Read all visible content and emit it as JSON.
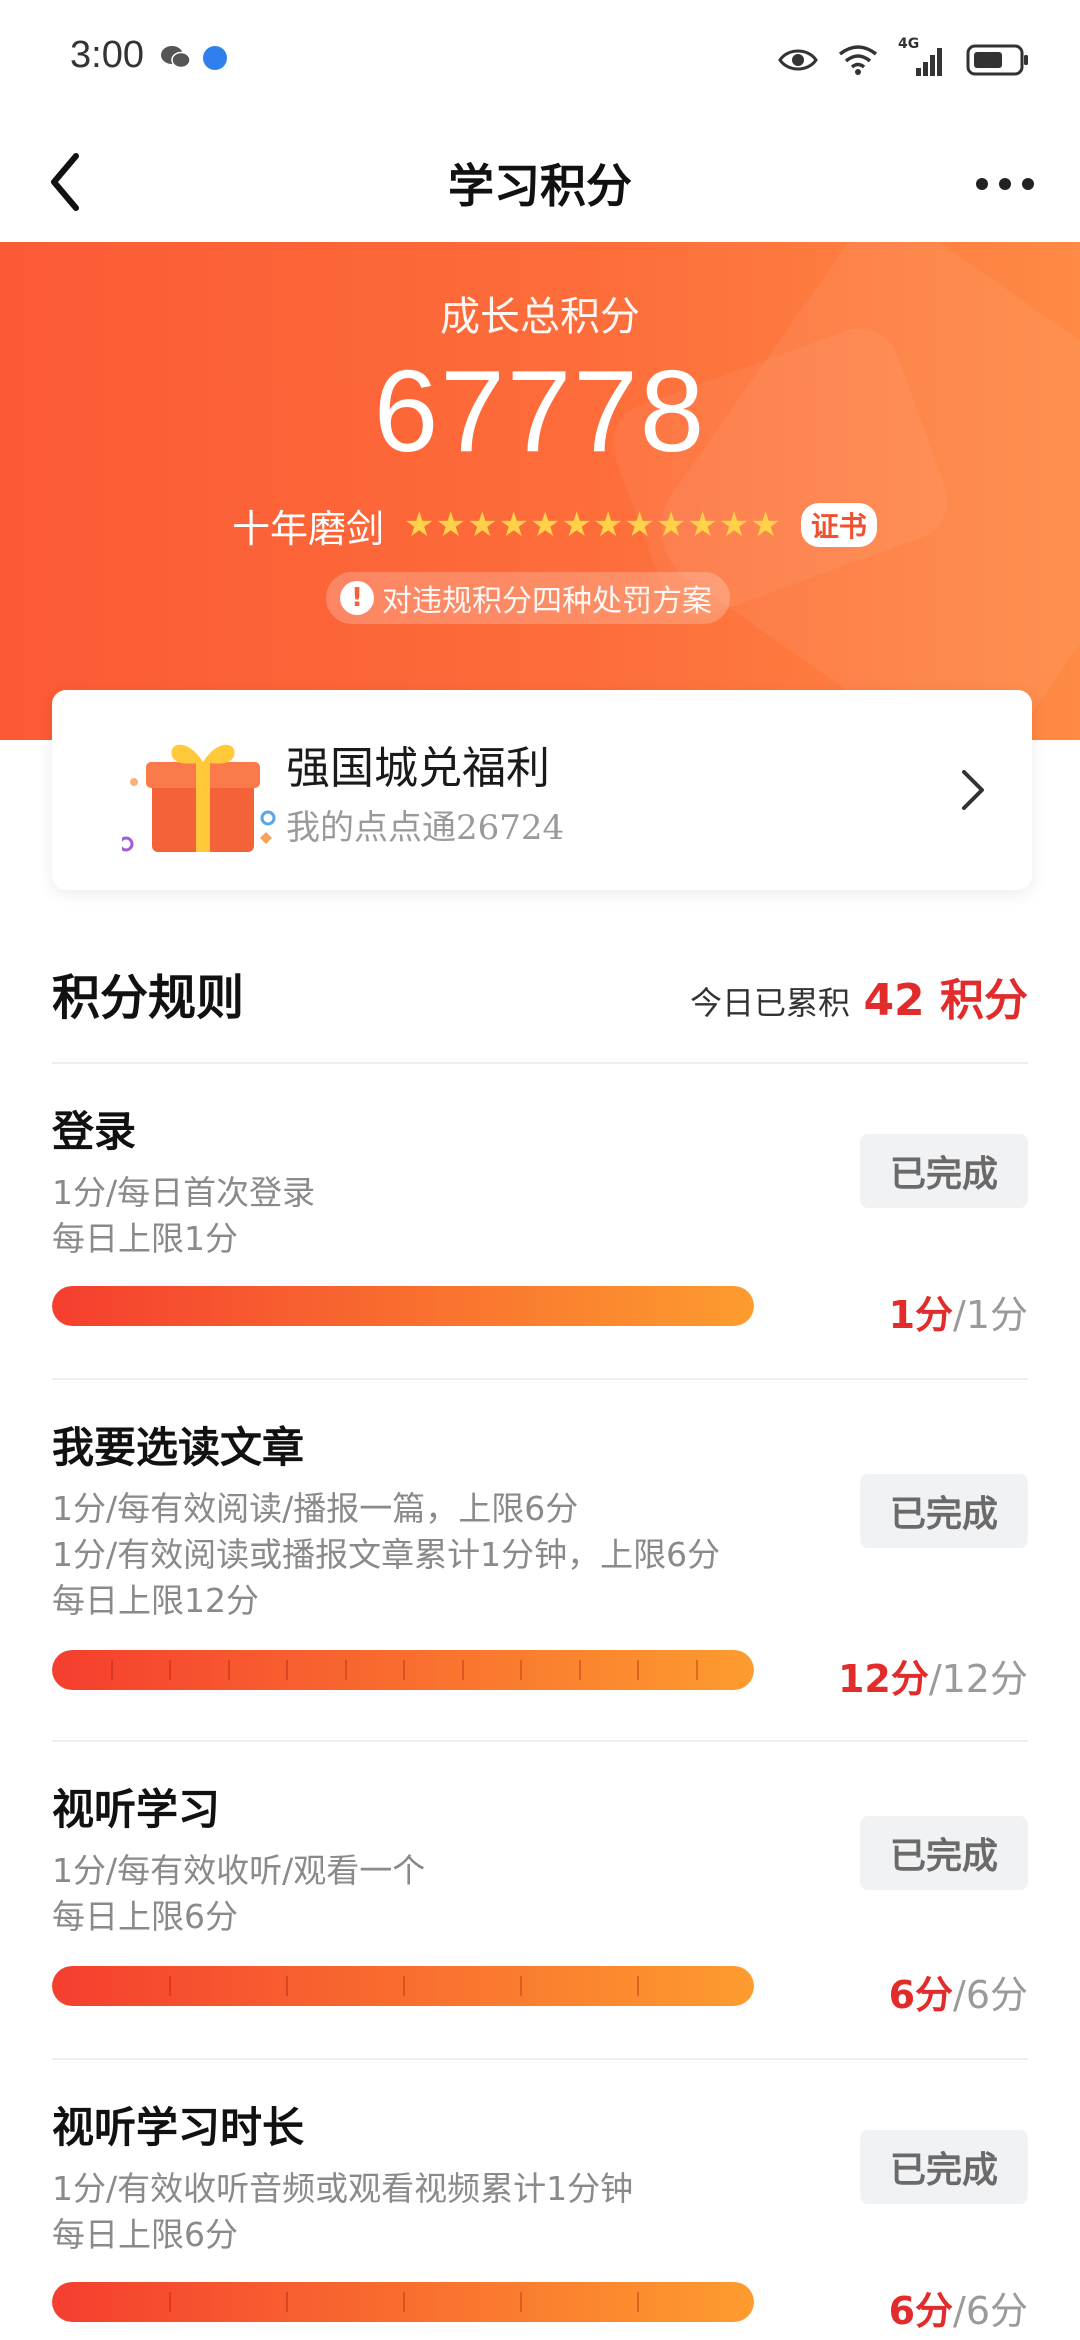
{
  "status_bar": {
    "time": "3:00",
    "network": "4G"
  },
  "nav": {
    "title": "学习积分"
  },
  "hero": {
    "label": "成长总积分",
    "score": "67778",
    "rank_name": "十年磨剑",
    "star_count": 12,
    "cert_label": "证书",
    "notice_icon": "!",
    "notice": "对违规积分四种处罚方案"
  },
  "welfare": {
    "title": "强国城兑福利",
    "subtitle": "我的点点通26724"
  },
  "rules": {
    "title": "积分规则",
    "today_label": "今日已累积",
    "today_value": "42 积分"
  },
  "tasks": [
    {
      "name": "登录",
      "desc": [
        "1分/每日首次登录",
        "每日上限1分"
      ],
      "button": "已完成",
      "earned": "1分",
      "limit": "/1分",
      "progress": 1.0,
      "segments": 1
    },
    {
      "name": "我要选读文章",
      "desc": [
        "1分/每有效阅读/播报一篇，上限6分",
        "1分/有效阅读或播报文章累计1分钟，上限6分",
        "每日上限12分"
      ],
      "button": "已完成",
      "earned": "12分",
      "limit": "/12分",
      "progress": 1.0,
      "segments": 12
    },
    {
      "name": "视听学习",
      "desc": [
        "1分/每有效收听/观看一个",
        "每日上限6分"
      ],
      "button": "已完成",
      "earned": "6分",
      "limit": "/6分",
      "progress": 1.0,
      "segments": 6
    },
    {
      "name": "视听学习时长",
      "desc": [
        "1分/有效收听音频或观看视频累计1分钟",
        "每日上限6分"
      ],
      "button": "已完成",
      "earned": "6分",
      "limit": "/6分",
      "progress": 1.0,
      "segments": 6
    }
  ]
}
